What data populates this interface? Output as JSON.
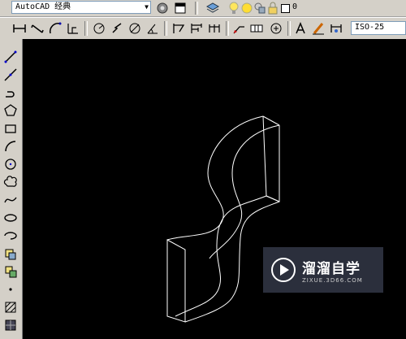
{
  "workspace": {
    "label": "AutoCAD 经典"
  },
  "layer": {
    "label": "0"
  },
  "dimstyle": {
    "label": "ISO-25"
  },
  "watermark": {
    "main": "溜溜自学",
    "sub": "ZIXUE.3D66.COM"
  },
  "colors": {
    "canvas": "#000000",
    "drawing": "#ffffff",
    "toolbar": "#d4d0c8"
  }
}
